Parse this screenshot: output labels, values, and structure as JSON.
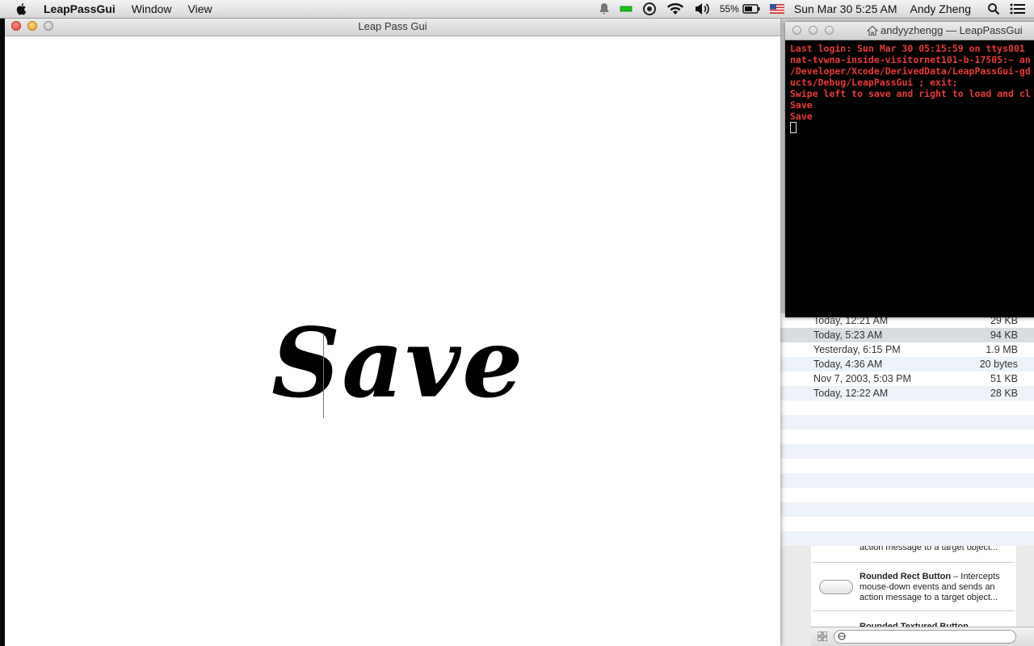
{
  "menubar": {
    "app_name": "LeapPassGui",
    "menus": [
      "Window",
      "View"
    ],
    "battery": "55%",
    "datetime": "Sun Mar 30  5:25 AM",
    "user": "Andy Zheng"
  },
  "app_window": {
    "title": "Leap Pass Gui",
    "display_text": "Save"
  },
  "terminal": {
    "title": "andyyzhengg — LeapPassGui",
    "lines": [
      "Last login: Sun Mar 30 05:15:59 on ttys001",
      "nat-tvwna-inside-visitornet101-b-17505:~ an",
      "/Developer/Xcode/DerivedData/LeapPassGui-gd",
      "ucts/Debug/LeapPassGui ; exit;",
      "Swipe left to save and right to load and cl",
      "Save",
      "Save"
    ]
  },
  "file_list": {
    "rows": [
      {
        "date": "Today, 12:21 AM",
        "size": "29 KB"
      },
      {
        "date": "Today, 5:23 AM",
        "size": "94 KB"
      },
      {
        "date": "Yesterday, 6:15 PM",
        "size": "1.9 MB"
      },
      {
        "date": "Today, 4:36 AM",
        "size": "20 bytes"
      },
      {
        "date": "Nov 7, 2003, 5:03 PM",
        "size": "51 KB"
      },
      {
        "date": "Today, 12:22 AM",
        "size": "28 KB"
      }
    ]
  },
  "library": {
    "item1_desc": "action message to a target object...",
    "item2_name": "Rounded Rect Button",
    "item2_desc": " – Intercepts mouse-down events and sends an action message to a target object...",
    "item3_name": "Rounded Textured Button"
  },
  "colors": {
    "terminal_text": "#e83a3a",
    "terminal_bg": "#000000"
  }
}
